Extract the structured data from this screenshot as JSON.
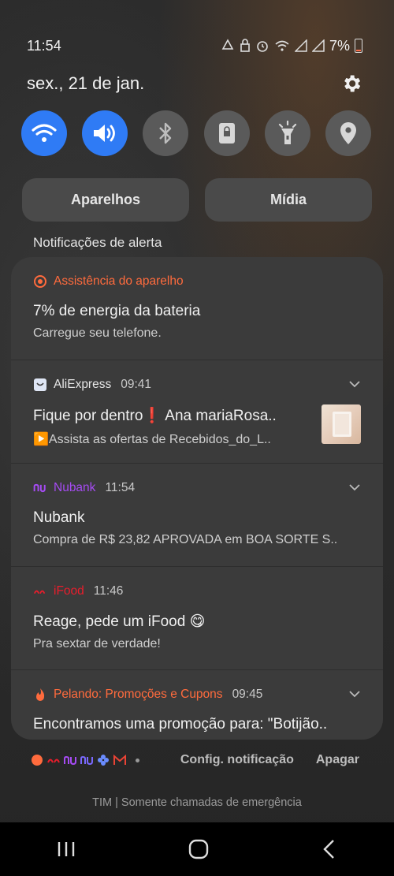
{
  "status": {
    "time": "11:54",
    "battery": "7%"
  },
  "date": "sex., 21 de jan.",
  "quick_settings": [
    {
      "name": "wifi",
      "on": true
    },
    {
      "name": "sound",
      "on": true
    },
    {
      "name": "bluetooth",
      "on": false
    },
    {
      "name": "rotation-lock",
      "on": false
    },
    {
      "name": "flashlight",
      "on": false
    },
    {
      "name": "location",
      "on": false
    }
  ],
  "pills": {
    "devices": "Aparelhos",
    "media": "Mídia"
  },
  "section_label": "Notificações de alerta",
  "notifications": [
    {
      "app": "Assistência do aparelho",
      "app_color": "#ff6b3d",
      "time": "",
      "title": "7% de energia da bateria",
      "text": "Carregue seu telefone."
    },
    {
      "app": "AliExpress",
      "app_color": "#e8e8e8",
      "time": "09:41",
      "title": "Fique por dentro❗ Ana mariaRosa..",
      "text": "▶️Assista as ofertas de Recebidos_do_L.."
    },
    {
      "app": "Nubank",
      "app_color": "#a64bf4",
      "time": "11:54",
      "title": "Nubank",
      "text": "Compra de R$ 23,82 APROVADA em BOA SORTE S.."
    },
    {
      "app": "iFood",
      "app_color": "#ea1d2c",
      "time": "11:46",
      "title": "Reage, pede um iFood 😋",
      "text": "Pra sextar de verdade!"
    },
    {
      "app": "Pelando: Promoções e Cupons",
      "app_color": "#ff6b3d",
      "time": "09:45",
      "title": "Encontramos uma promoção para: \"Botijão..",
      "text": ""
    }
  ],
  "footer": {
    "settings": "Config. notificação",
    "clear": "Apagar"
  },
  "emergency": "TIM | Somente chamadas de emergência"
}
